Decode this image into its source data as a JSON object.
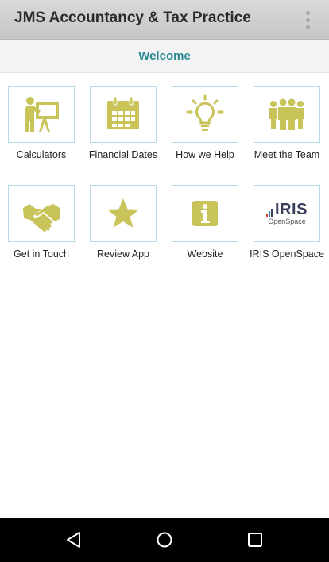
{
  "appbar": {
    "title": "JMS Accountancy & Tax Practice",
    "menu_icon": "more-vert-icon"
  },
  "subbar": {
    "title": "Welcome"
  },
  "theme": {
    "icon_color": "#c9c45a",
    "title_color": "#2b8a93",
    "tile_border": "#b6dbe6"
  },
  "tiles": [
    {
      "label": "Calculators",
      "icon": "presentation-icon"
    },
    {
      "label": "Financial Dates",
      "icon": "calendar-icon"
    },
    {
      "label": "How we Help",
      "icon": "lightbulb-icon"
    },
    {
      "label": "Meet the Team",
      "icon": "team-icon"
    },
    {
      "label": "Get in Touch",
      "icon": "handshake-icon"
    },
    {
      "label": "Review App",
      "icon": "star-icon"
    },
    {
      "label": "Website",
      "icon": "info-icon"
    },
    {
      "label": "IRIS OpenSpace",
      "icon": "iris-logo",
      "logo_text": "IRIS",
      "logo_subtext": "OpenSpace"
    }
  ],
  "navbar": {
    "back": "back-icon",
    "home": "home-icon",
    "recents": "recents-icon"
  }
}
